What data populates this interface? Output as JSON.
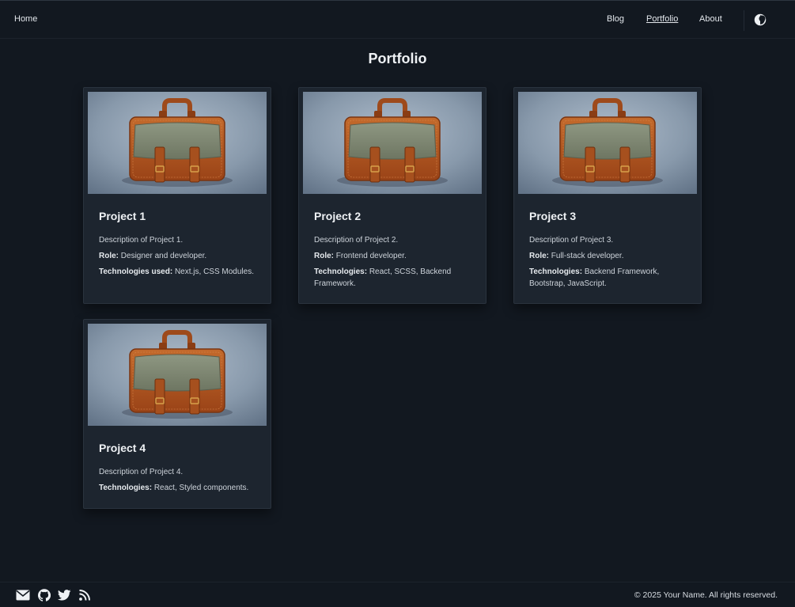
{
  "nav": {
    "home": "Home",
    "links": [
      "Blog",
      "Portfolio",
      "About"
    ],
    "active": "Portfolio",
    "theme_toggle_icon": "half-moon-icon"
  },
  "page_title": "Portfolio",
  "projects": [
    {
      "title": "Project 1",
      "description": "Description of Project 1.",
      "details": [
        {
          "label": "Role:",
          "value": "Designer and developer."
        },
        {
          "label": "Technologies used:",
          "value": "Next.js, CSS Modules."
        }
      ]
    },
    {
      "title": "Project 2",
      "description": "Description of Project 2.",
      "details": [
        {
          "label": "Role:",
          "value": "Frontend developer."
        },
        {
          "label": "Technologies:",
          "value": "React, SCSS, Backend Framework."
        }
      ]
    },
    {
      "title": "Project 3",
      "description": "Description of Project 3.",
      "details": [
        {
          "label": "Role:",
          "value": "Full-stack developer."
        },
        {
          "label": "Technologies:",
          "value": "Backend Framework, Bootstrap, JavaScript."
        }
      ]
    },
    {
      "title": "Project 4",
      "description": "Description of Project 4.",
      "details": [
        {
          "label": "Technologies:",
          "value": "React, Styled components."
        }
      ]
    }
  ],
  "footer": {
    "icons": [
      "mail-icon",
      "github-icon",
      "twitter-icon",
      "rss-icon"
    ],
    "copyright": "© 2025 Your Name. All rights reserved."
  },
  "colors": {
    "background": "#121820",
    "card": "#1d252f",
    "text": "#d7dce2"
  }
}
